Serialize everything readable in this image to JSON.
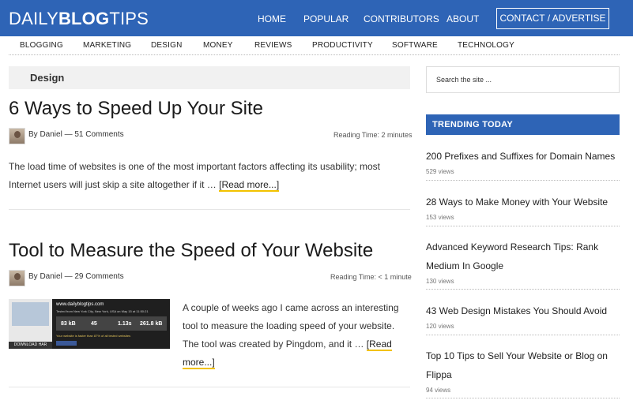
{
  "header": {
    "logo_light_1": "DAILY",
    "logo_bold": "BLOG",
    "logo_light_2": "TIPS",
    "nav": [
      "HOME",
      "POPULAR",
      "CONTRIBUTORS",
      "ABOUT"
    ],
    "contact": "CONTACT / ADVERTISE"
  },
  "categories": [
    "BLOGGING",
    "MARKETING",
    "DESIGN",
    "MONEY",
    "REVIEWS",
    "PRODUCTIVITY",
    "SOFTWARE",
    "TECHNOLOGY"
  ],
  "page_category": "Design",
  "posts": [
    {
      "title": "6 Ways to Speed Up Your Site",
      "by": "By",
      "author": "Daniel",
      "dash": "—",
      "comments": "51 Comments",
      "reading": "Reading Time: 2 minutes",
      "excerpt": "The load time of websites is one of the most important factors affecting its usability; most Internet users will just skip a site altogether if it …",
      "read_more": "[Read more...]"
    },
    {
      "title": "Tool to Measure the Speed of Your Website",
      "by": "By",
      "author": "Daniel",
      "dash": "—",
      "comments": "29 Comments",
      "reading": "Reading Time: < 1 minute",
      "excerpt": "A couple of weeks ago I came across an interesting tool to measure the loading speed of your website. The tool was created by Pingdom, and it …",
      "read_more": "[Read more...]",
      "thumbnail": {
        "site": "www.dailyblogtips.com",
        "tested": "Tested from New York City, New York, USA on May 15 at 11:50:21",
        "stats": [
          "83 kB",
          "45",
          "1.13s",
          "261.8 kB"
        ],
        "note": "Your website is faster than 87% of all tested websites",
        "download": "DOWNLOAD HAR"
      }
    }
  ],
  "sidebar": {
    "search_placeholder": "Search the site ...",
    "trending_heading": "TRENDING TODAY",
    "trending": [
      {
        "title": "200 Prefixes and Suffixes for Domain Names",
        "views": "529 views"
      },
      {
        "title": "28 Ways to Make Money with Your Website",
        "views": "153 views"
      },
      {
        "title": "Advanced Keyword Research Tips: Rank Medium In Google",
        "views": "130 views"
      },
      {
        "title": "43 Web Design Mistakes You Should Avoid",
        "views": "120 views"
      },
      {
        "title": "Top 10 Tips to Sell Your Website or Blog on Flippa",
        "views": "94 views"
      }
    ]
  },
  "colors": {
    "brand": "#2e64b6",
    "accent_underline": "#f2c200"
  }
}
